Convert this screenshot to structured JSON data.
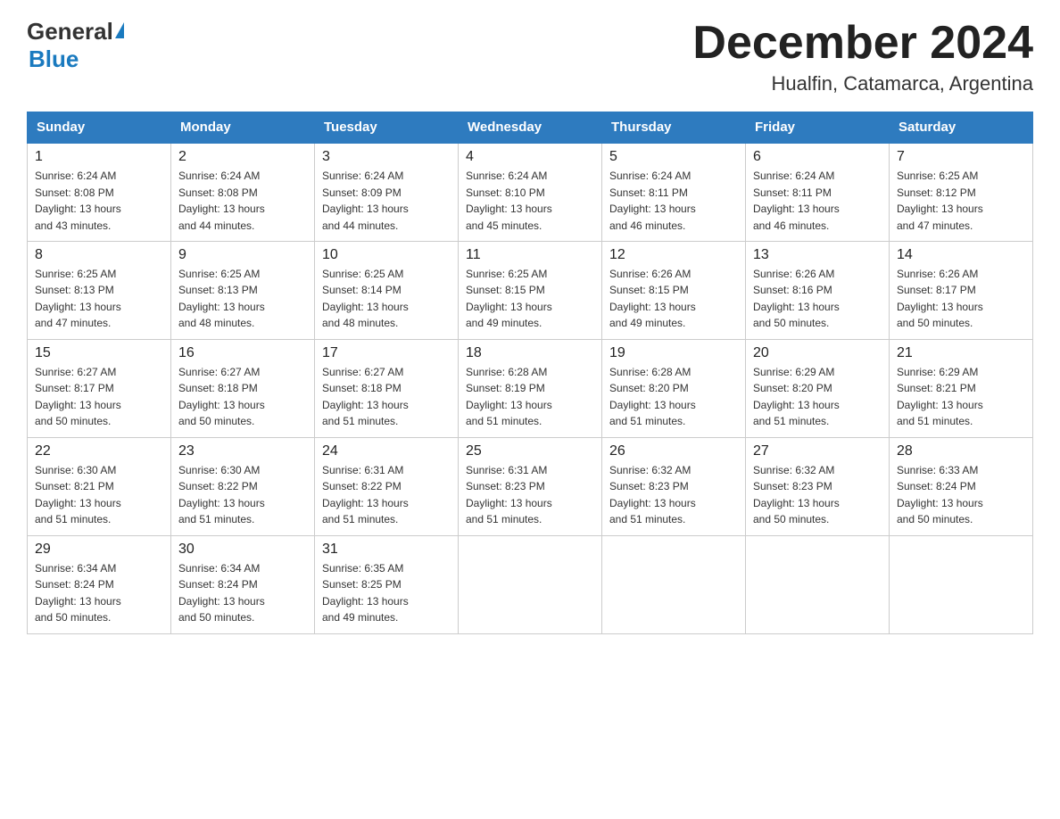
{
  "header": {
    "logo_general": "General",
    "logo_blue": "Blue",
    "month": "December 2024",
    "location": "Hualfin, Catamarca, Argentina"
  },
  "days_of_week": [
    "Sunday",
    "Monday",
    "Tuesday",
    "Wednesday",
    "Thursday",
    "Friday",
    "Saturday"
  ],
  "weeks": [
    [
      {
        "day": "1",
        "sunrise": "6:24 AM",
        "sunset": "8:08 PM",
        "daylight": "13 hours and 43 minutes."
      },
      {
        "day": "2",
        "sunrise": "6:24 AM",
        "sunset": "8:08 PM",
        "daylight": "13 hours and 44 minutes."
      },
      {
        "day": "3",
        "sunrise": "6:24 AM",
        "sunset": "8:09 PM",
        "daylight": "13 hours and 44 minutes."
      },
      {
        "day": "4",
        "sunrise": "6:24 AM",
        "sunset": "8:10 PM",
        "daylight": "13 hours and 45 minutes."
      },
      {
        "day": "5",
        "sunrise": "6:24 AM",
        "sunset": "8:11 PM",
        "daylight": "13 hours and 46 minutes."
      },
      {
        "day": "6",
        "sunrise": "6:24 AM",
        "sunset": "8:11 PM",
        "daylight": "13 hours and 46 minutes."
      },
      {
        "day": "7",
        "sunrise": "6:25 AM",
        "sunset": "8:12 PM",
        "daylight": "13 hours and 47 minutes."
      }
    ],
    [
      {
        "day": "8",
        "sunrise": "6:25 AM",
        "sunset": "8:13 PM",
        "daylight": "13 hours and 47 minutes."
      },
      {
        "day": "9",
        "sunrise": "6:25 AM",
        "sunset": "8:13 PM",
        "daylight": "13 hours and 48 minutes."
      },
      {
        "day": "10",
        "sunrise": "6:25 AM",
        "sunset": "8:14 PM",
        "daylight": "13 hours and 48 minutes."
      },
      {
        "day": "11",
        "sunrise": "6:25 AM",
        "sunset": "8:15 PM",
        "daylight": "13 hours and 49 minutes."
      },
      {
        "day": "12",
        "sunrise": "6:26 AM",
        "sunset": "8:15 PM",
        "daylight": "13 hours and 49 minutes."
      },
      {
        "day": "13",
        "sunrise": "6:26 AM",
        "sunset": "8:16 PM",
        "daylight": "13 hours and 50 minutes."
      },
      {
        "day": "14",
        "sunrise": "6:26 AM",
        "sunset": "8:17 PM",
        "daylight": "13 hours and 50 minutes."
      }
    ],
    [
      {
        "day": "15",
        "sunrise": "6:27 AM",
        "sunset": "8:17 PM",
        "daylight": "13 hours and 50 minutes."
      },
      {
        "day": "16",
        "sunrise": "6:27 AM",
        "sunset": "8:18 PM",
        "daylight": "13 hours and 50 minutes."
      },
      {
        "day": "17",
        "sunrise": "6:27 AM",
        "sunset": "8:18 PM",
        "daylight": "13 hours and 51 minutes."
      },
      {
        "day": "18",
        "sunrise": "6:28 AM",
        "sunset": "8:19 PM",
        "daylight": "13 hours and 51 minutes."
      },
      {
        "day": "19",
        "sunrise": "6:28 AM",
        "sunset": "8:20 PM",
        "daylight": "13 hours and 51 minutes."
      },
      {
        "day": "20",
        "sunrise": "6:29 AM",
        "sunset": "8:20 PM",
        "daylight": "13 hours and 51 minutes."
      },
      {
        "day": "21",
        "sunrise": "6:29 AM",
        "sunset": "8:21 PM",
        "daylight": "13 hours and 51 minutes."
      }
    ],
    [
      {
        "day": "22",
        "sunrise": "6:30 AM",
        "sunset": "8:21 PM",
        "daylight": "13 hours and 51 minutes."
      },
      {
        "day": "23",
        "sunrise": "6:30 AM",
        "sunset": "8:22 PM",
        "daylight": "13 hours and 51 minutes."
      },
      {
        "day": "24",
        "sunrise": "6:31 AM",
        "sunset": "8:22 PM",
        "daylight": "13 hours and 51 minutes."
      },
      {
        "day": "25",
        "sunrise": "6:31 AM",
        "sunset": "8:23 PM",
        "daylight": "13 hours and 51 minutes."
      },
      {
        "day": "26",
        "sunrise": "6:32 AM",
        "sunset": "8:23 PM",
        "daylight": "13 hours and 51 minutes."
      },
      {
        "day": "27",
        "sunrise": "6:32 AM",
        "sunset": "8:23 PM",
        "daylight": "13 hours and 50 minutes."
      },
      {
        "day": "28",
        "sunrise": "6:33 AM",
        "sunset": "8:24 PM",
        "daylight": "13 hours and 50 minutes."
      }
    ],
    [
      {
        "day": "29",
        "sunrise": "6:34 AM",
        "sunset": "8:24 PM",
        "daylight": "13 hours and 50 minutes."
      },
      {
        "day": "30",
        "sunrise": "6:34 AM",
        "sunset": "8:24 PM",
        "daylight": "13 hours and 50 minutes."
      },
      {
        "day": "31",
        "sunrise": "6:35 AM",
        "sunset": "8:25 PM",
        "daylight": "13 hours and 49 minutes."
      },
      null,
      null,
      null,
      null
    ]
  ],
  "labels": {
    "sunrise": "Sunrise:",
    "sunset": "Sunset:",
    "daylight": "Daylight:"
  }
}
